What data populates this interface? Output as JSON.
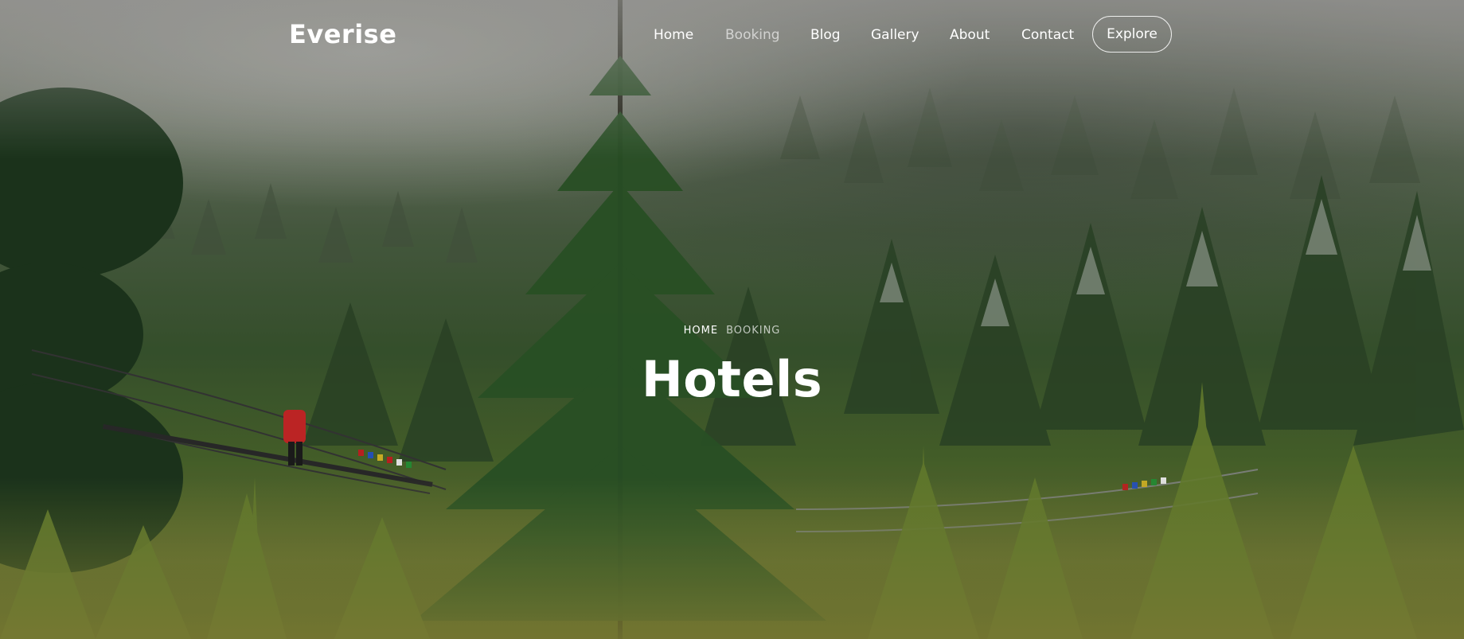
{
  "brand": {
    "name": "Everise"
  },
  "nav": {
    "items": [
      {
        "label": "Home",
        "active": false
      },
      {
        "label": "Booking",
        "active": true
      },
      {
        "label": "Blog",
        "active": false
      },
      {
        "label": "Gallery",
        "active": false
      },
      {
        "label": "About",
        "active": false
      },
      {
        "label": "Contact",
        "active": false
      }
    ],
    "cta_label": "Explore"
  },
  "hero": {
    "breadcrumb": {
      "home": "HOME",
      "current": "BOOKING"
    },
    "title": "Hotels"
  },
  "colors": {
    "text": "#ffffff",
    "muted_nav": "#c7c9c5"
  }
}
